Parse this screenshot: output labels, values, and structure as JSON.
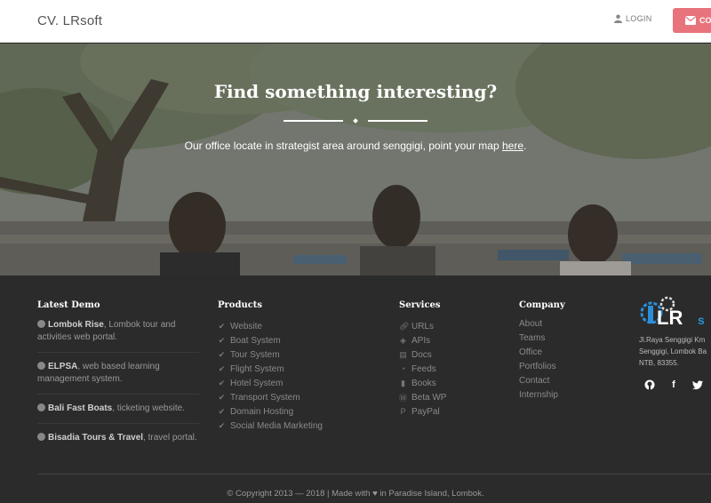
{
  "navbar": {
    "brand": "CV. LRsoft",
    "login_label": "LOGIN",
    "contact_label": "CO"
  },
  "hero": {
    "title": "Find something interesting?",
    "text_before": "Our office locate in strategist area around senggigi, point your map ",
    "link_label": "here",
    "text_after": "."
  },
  "footer": {
    "latest_demo": {
      "title": "Latest Demo",
      "items": [
        {
          "name": "Lombok Rise",
          "desc": ", Lombok tour and activities web portal."
        },
        {
          "name": "ELPSA",
          "desc": ", web based learning management system."
        },
        {
          "name": "Bali Fast Boats",
          "desc": ", ticketing website."
        },
        {
          "name": "Bisadia Tours & Travel",
          "desc": ", travel portal."
        }
      ]
    },
    "products": {
      "title": "Products",
      "items": [
        "Website",
        "Boat System",
        "Tour System",
        "Flight System",
        "Hotel System",
        "Transport System",
        "Domain Hosting",
        "Social Media Marketing"
      ]
    },
    "services": {
      "title": "Services",
      "items": [
        {
          "label": "URLs",
          "icon": "link-icon"
        },
        {
          "label": "APIs",
          "icon": "cube-icon"
        },
        {
          "label": "Docs",
          "icon": "book-icon"
        },
        {
          "label": "Feeds",
          "icon": "rss-icon"
        },
        {
          "label": "Books",
          "icon": "bookmark-icon"
        },
        {
          "label": "Beta WP",
          "icon": "wordpress-icon"
        },
        {
          "label": "PayPal",
          "icon": "paypal-icon"
        }
      ]
    },
    "company": {
      "title": "Company",
      "items": [
        "About",
        "Teams",
        "Office",
        "Portfolios",
        "Contact",
        "Internship"
      ]
    },
    "address": {
      "line1": "Jl.Raya Senggigi Km",
      "line2": "Senggigi, Lombok Ba",
      "line3": "NTB, 83355."
    },
    "copyright": "© Copyright 2013 — 2018 | Made with",
    "copyright_end": "in Paradise Island, Lombok."
  },
  "colors": {
    "accent": "#e8737c",
    "footer_bg": "#2b2b2b",
    "logo_blue": "#2a8fd8"
  }
}
